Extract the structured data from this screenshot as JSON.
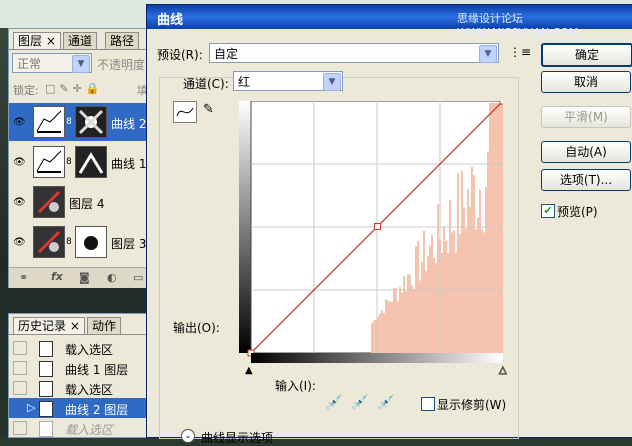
{
  "window": {
    "title": "曲线",
    "watermark": "思缘设计论坛 WWW.MISSYUAN.COM"
  },
  "layers_panel": {
    "tabs": [
      "图层 ×",
      "通道",
      "路径"
    ],
    "blend_mode": "正常",
    "opacity_label": "不透明度",
    "lock_label": "锁定:",
    "fill_label": "填充",
    "layers": [
      {
        "name": "曲线 2",
        "selected": true
      },
      {
        "name": "曲线 1",
        "selected": false
      },
      {
        "name": "图层 4",
        "selected": false
      },
      {
        "name": "图层 3",
        "selected": false
      }
    ],
    "footer_icons": [
      "link-icon",
      "fx-icon",
      "mask-icon",
      "adjustment-icon",
      "folder-icon"
    ]
  },
  "history_panel": {
    "tabs": [
      "历史记录 ×",
      "动作"
    ],
    "items": [
      {
        "label": "载入选区",
        "selected": false
      },
      {
        "label": "曲线 1 图层",
        "selected": false
      },
      {
        "label": "载入选区",
        "selected": false
      },
      {
        "label": "曲线 2 图层",
        "selected": true
      },
      {
        "label": "载入选区",
        "selected": false
      }
    ]
  },
  "curves": {
    "preset_label": "预设(R):",
    "preset_value": "自定",
    "channel_label": "通道(C):",
    "channel_value": "红",
    "output_label": "输出(O):",
    "input_label": "输入(I):",
    "show_clipping_label": "显示修剪(W)",
    "show_clipping_checked": false,
    "display_options_label": "曲线显示选项",
    "buttons": {
      "ok": "确定",
      "cancel": "取消",
      "smooth": "平滑(M)",
      "auto": "自动(A)",
      "options": "选项(T)..."
    },
    "preview_label": "预览(P)",
    "preview_checked": true,
    "curve_points": [
      [
        0,
        0
      ],
      [
        128,
        128
      ],
      [
        255,
        255
      ]
    ],
    "accent_color": "#c0392b",
    "histogram_color": "#f6c4ae"
  }
}
